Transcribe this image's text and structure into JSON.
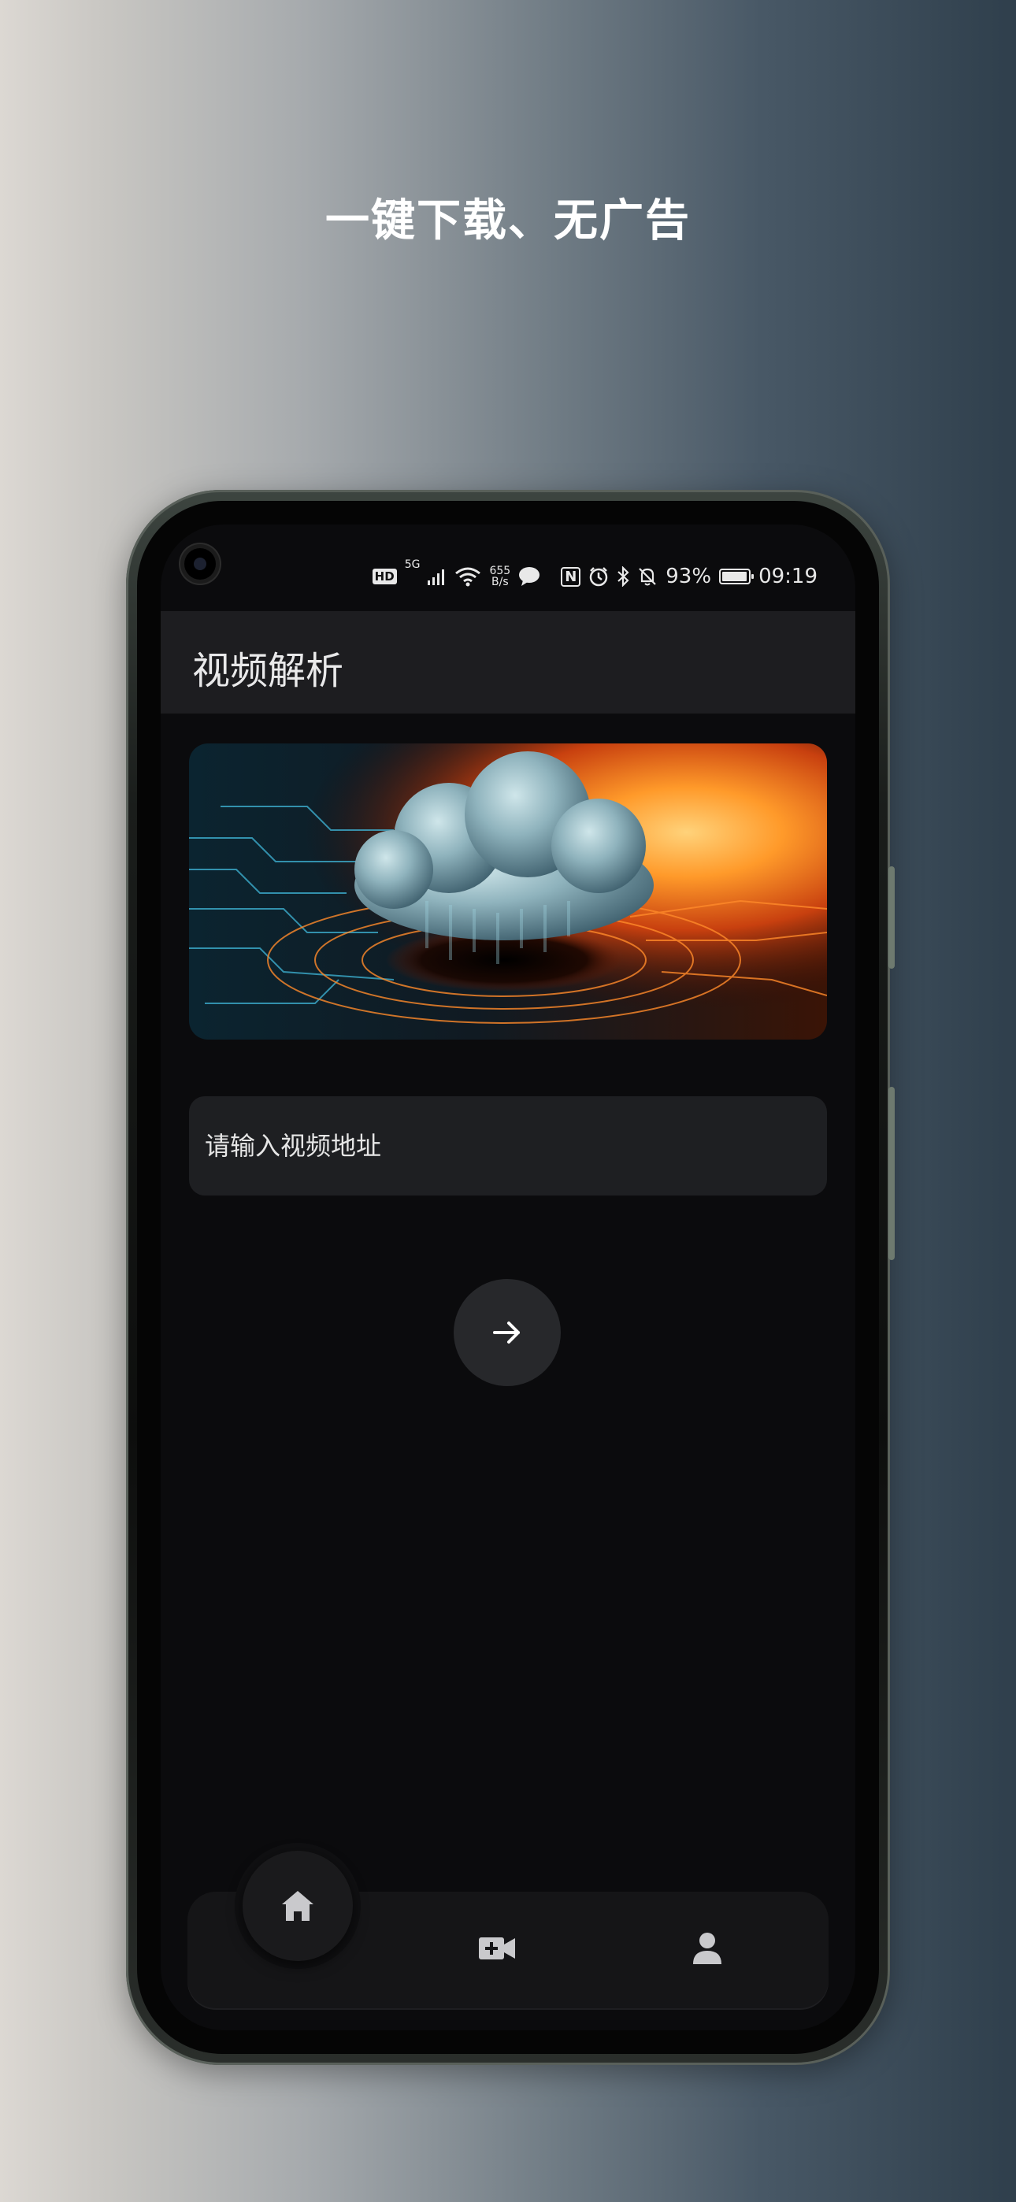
{
  "headline": "一键下载、无广告",
  "status_bar": {
    "network_badge": "HD",
    "network_type": "5G",
    "speed_value": "655",
    "speed_unit": "B/s",
    "nfc": "N",
    "battery": "93%",
    "time": "09:19"
  },
  "app": {
    "title": "视频解析",
    "url_input": {
      "placeholder": "请输入视频地址",
      "value": ""
    },
    "go_button_icon": "arrow-right-icon"
  },
  "bottom_nav": {
    "items": [
      {
        "icon": "home-icon",
        "active": true
      },
      {
        "icon": "video-add-icon",
        "active": false
      },
      {
        "icon": "person-icon",
        "active": false
      }
    ]
  },
  "colors": {
    "screen_bg": "#0b0b0d",
    "appbar_bg": "#1d1d20",
    "input_bg": "#1e1f22",
    "button_bg": "#27282b",
    "text": "#e9e9ea"
  }
}
